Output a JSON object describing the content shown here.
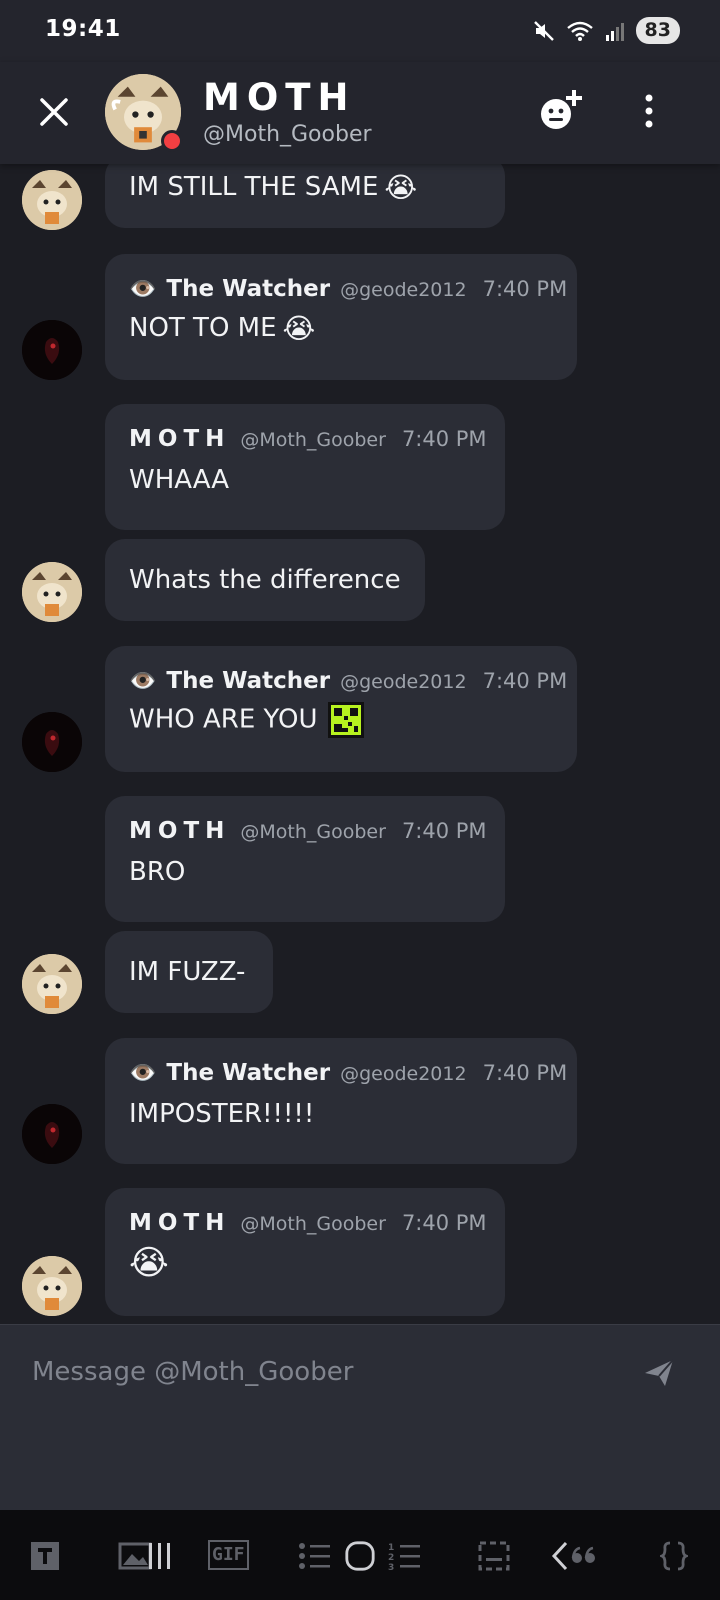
{
  "status_bar": {
    "time": "19:41",
    "battery": "83"
  },
  "header": {
    "name": "MOTH",
    "handle": "@Moth_Goober"
  },
  "messages": [
    {
      "author": "",
      "handle": "",
      "time": "",
      "text": "IM STILL THE SAME",
      "emoji": "😭"
    },
    {
      "author": "The Watcher",
      "author_icon": "👁️",
      "handle": "@geode2012",
      "time": "7:40 PM",
      "text": "NOT TO ME",
      "emoji": "😭"
    },
    {
      "author": "MOTH",
      "handle": "@Moth_Goober",
      "time": "7:40 PM",
      "text": "WHAAA"
    },
    {
      "author": "",
      "handle": "",
      "time": "",
      "text": "Whats the difference"
    },
    {
      "author": "The Watcher",
      "author_icon": "👁️",
      "handle": "@geode2012",
      "time": "7:40 PM",
      "text": "WHO ARE YOU",
      "emoji_icon": "qr-glitch-emoji"
    },
    {
      "author": "MOTH",
      "handle": "@Moth_Goober",
      "time": "7:40 PM",
      "text": "BRO"
    },
    {
      "author": "",
      "handle": "",
      "time": "",
      "text": "IM FUZZ-"
    },
    {
      "author": "The Watcher",
      "author_icon": "👁️",
      "handle": "@geode2012",
      "time": "7:40 PM",
      "text": "IMPOSTER!!!!!"
    },
    {
      "author": "MOTH",
      "handle": "@Moth_Goober",
      "time": "7:40 PM",
      "text": "",
      "emoji": "😭"
    }
  ],
  "composer": {
    "placeholder": "Message @Moth_Goober"
  },
  "keyboard_toolbar": {
    "gif_label": "GIF"
  },
  "colors": {
    "background": "#1c1d23",
    "bubble": "#2b2d36",
    "header": "#24252d",
    "status_dnd": "#f23f42"
  }
}
